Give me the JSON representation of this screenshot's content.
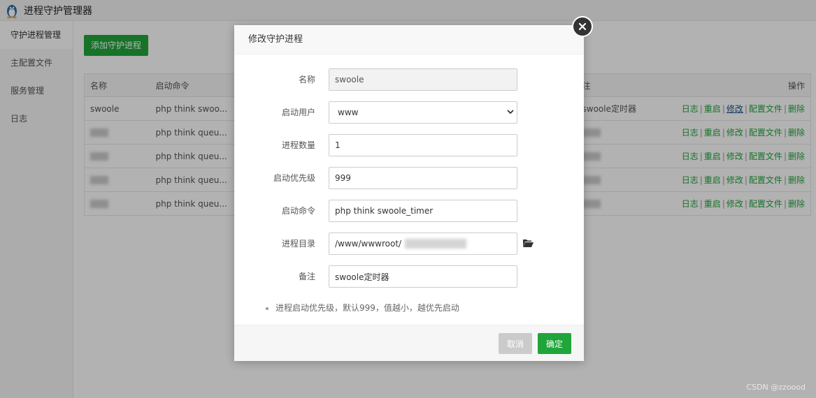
{
  "app": {
    "title": "进程守护管理器",
    "logo_icon": "linux-penguin-icon"
  },
  "sidebar": {
    "items": [
      {
        "label": "守护进程管理",
        "active": true
      },
      {
        "label": "主配置文件",
        "active": false
      },
      {
        "label": "服务管理",
        "active": false
      },
      {
        "label": "日志",
        "active": false
      }
    ]
  },
  "toolbar": {
    "add_label": "添加守护进程"
  },
  "table": {
    "headers": [
      "名称",
      "启动命令",
      "备注",
      "操作"
    ],
    "notes_header_visible": "注",
    "rows": [
      {
        "name": "swoole",
        "command": "php think swoo...",
        "note": "swoole定时器"
      },
      {
        "name": "",
        "command": "php think queu...",
        "note": ""
      },
      {
        "name": "",
        "command": "php think queu...",
        "note": ""
      },
      {
        "name": "",
        "command": "php think queu...",
        "note": ""
      },
      {
        "name": "",
        "command": "php think queu...",
        "note": ""
      }
    ],
    "actions": {
      "log": "日志",
      "restart": "重启",
      "edit": "修改",
      "config": "配置文件",
      "delete": "删除"
    }
  },
  "modal": {
    "title": "修改守护进程",
    "fields": {
      "name": {
        "label": "名称",
        "value": "swoole"
      },
      "user": {
        "label": "启动用户",
        "value": "www"
      },
      "count": {
        "label": "进程数量",
        "value": "1"
      },
      "priority": {
        "label": "启动优先级",
        "value": "999"
      },
      "command": {
        "label": "启动命令",
        "value": "php think swoole_timer"
      },
      "directory": {
        "label": "进程目录",
        "value": "/www/wwwroot/"
      },
      "note": {
        "label": "备注",
        "value": "swoole定时器"
      }
    },
    "hint": "进程启动优先级，默认999，值越小，越优先启动",
    "cancel_label": "取消",
    "ok_label": "确定"
  },
  "watermark": "CSDN @zzoood",
  "colors": {
    "accent": "#20a53a",
    "overlay": "rgba(0,0,0,0.3)"
  }
}
